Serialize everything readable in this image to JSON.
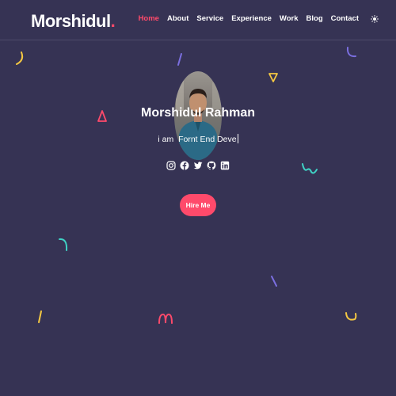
{
  "brand": {
    "name": "Morshidul",
    "dot": ".",
    "accent_color": "#ff4a6b"
  },
  "nav": {
    "items": [
      {
        "label": "Home",
        "active": true
      },
      {
        "label": "About"
      },
      {
        "label": "Service"
      },
      {
        "label": "Experience"
      },
      {
        "label": "Work"
      },
      {
        "label": "Blog"
      },
      {
        "label": "Contact"
      }
    ],
    "theme_toggle_icon": "sun-icon"
  },
  "hero": {
    "name": "Morshidul Rahman",
    "tagline_prefix": "i am",
    "tagline_typed": "Fornt End Deve",
    "socials": [
      "instagram-icon",
      "facebook-icon",
      "twitter-icon",
      "github-icon",
      "linkedin-icon"
    ],
    "cta_label": "Hire Me"
  },
  "colors": {
    "background": "#363354",
    "accent": "#ff4a6b",
    "confetti_yellow": "#f5c842",
    "confetti_teal": "#3fd1c4",
    "confetti_purple": "#7b6fe0"
  }
}
